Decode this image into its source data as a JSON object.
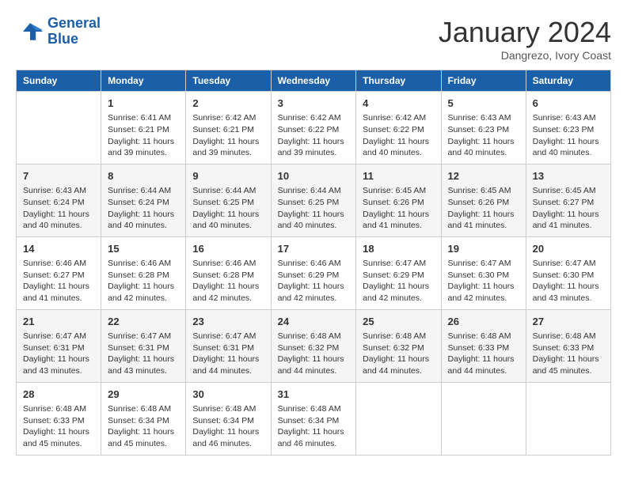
{
  "logo": {
    "line1": "General",
    "line2": "Blue"
  },
  "title": "January 2024",
  "subtitle": "Dangrezo, Ivory Coast",
  "header_days": [
    "Sunday",
    "Monday",
    "Tuesday",
    "Wednesday",
    "Thursday",
    "Friday",
    "Saturday"
  ],
  "weeks": [
    [
      {
        "day": "",
        "sunrise": "",
        "sunset": "",
        "daylight": ""
      },
      {
        "day": "1",
        "sunrise": "Sunrise: 6:41 AM",
        "sunset": "Sunset: 6:21 PM",
        "daylight": "Daylight: 11 hours and 39 minutes."
      },
      {
        "day": "2",
        "sunrise": "Sunrise: 6:42 AM",
        "sunset": "Sunset: 6:21 PM",
        "daylight": "Daylight: 11 hours and 39 minutes."
      },
      {
        "day": "3",
        "sunrise": "Sunrise: 6:42 AM",
        "sunset": "Sunset: 6:22 PM",
        "daylight": "Daylight: 11 hours and 39 minutes."
      },
      {
        "day": "4",
        "sunrise": "Sunrise: 6:42 AM",
        "sunset": "Sunset: 6:22 PM",
        "daylight": "Daylight: 11 hours and 40 minutes."
      },
      {
        "day": "5",
        "sunrise": "Sunrise: 6:43 AM",
        "sunset": "Sunset: 6:23 PM",
        "daylight": "Daylight: 11 hours and 40 minutes."
      },
      {
        "day": "6",
        "sunrise": "Sunrise: 6:43 AM",
        "sunset": "Sunset: 6:23 PM",
        "daylight": "Daylight: 11 hours and 40 minutes."
      }
    ],
    [
      {
        "day": "7",
        "sunrise": "Sunrise: 6:43 AM",
        "sunset": "Sunset: 6:24 PM",
        "daylight": "Daylight: 11 hours and 40 minutes."
      },
      {
        "day": "8",
        "sunrise": "Sunrise: 6:44 AM",
        "sunset": "Sunset: 6:24 PM",
        "daylight": "Daylight: 11 hours and 40 minutes."
      },
      {
        "day": "9",
        "sunrise": "Sunrise: 6:44 AM",
        "sunset": "Sunset: 6:25 PM",
        "daylight": "Daylight: 11 hours and 40 minutes."
      },
      {
        "day": "10",
        "sunrise": "Sunrise: 6:44 AM",
        "sunset": "Sunset: 6:25 PM",
        "daylight": "Daylight: 11 hours and 40 minutes."
      },
      {
        "day": "11",
        "sunrise": "Sunrise: 6:45 AM",
        "sunset": "Sunset: 6:26 PM",
        "daylight": "Daylight: 11 hours and 41 minutes."
      },
      {
        "day": "12",
        "sunrise": "Sunrise: 6:45 AM",
        "sunset": "Sunset: 6:26 PM",
        "daylight": "Daylight: 11 hours and 41 minutes."
      },
      {
        "day": "13",
        "sunrise": "Sunrise: 6:45 AM",
        "sunset": "Sunset: 6:27 PM",
        "daylight": "Daylight: 11 hours and 41 minutes."
      }
    ],
    [
      {
        "day": "14",
        "sunrise": "Sunrise: 6:46 AM",
        "sunset": "Sunset: 6:27 PM",
        "daylight": "Daylight: 11 hours and 41 minutes."
      },
      {
        "day": "15",
        "sunrise": "Sunrise: 6:46 AM",
        "sunset": "Sunset: 6:28 PM",
        "daylight": "Daylight: 11 hours and 42 minutes."
      },
      {
        "day": "16",
        "sunrise": "Sunrise: 6:46 AM",
        "sunset": "Sunset: 6:28 PM",
        "daylight": "Daylight: 11 hours and 42 minutes."
      },
      {
        "day": "17",
        "sunrise": "Sunrise: 6:46 AM",
        "sunset": "Sunset: 6:29 PM",
        "daylight": "Daylight: 11 hours and 42 minutes."
      },
      {
        "day": "18",
        "sunrise": "Sunrise: 6:47 AM",
        "sunset": "Sunset: 6:29 PM",
        "daylight": "Daylight: 11 hours and 42 minutes."
      },
      {
        "day": "19",
        "sunrise": "Sunrise: 6:47 AM",
        "sunset": "Sunset: 6:30 PM",
        "daylight": "Daylight: 11 hours and 42 minutes."
      },
      {
        "day": "20",
        "sunrise": "Sunrise: 6:47 AM",
        "sunset": "Sunset: 6:30 PM",
        "daylight": "Daylight: 11 hours and 43 minutes."
      }
    ],
    [
      {
        "day": "21",
        "sunrise": "Sunrise: 6:47 AM",
        "sunset": "Sunset: 6:31 PM",
        "daylight": "Daylight: 11 hours and 43 minutes."
      },
      {
        "day": "22",
        "sunrise": "Sunrise: 6:47 AM",
        "sunset": "Sunset: 6:31 PM",
        "daylight": "Daylight: 11 hours and 43 minutes."
      },
      {
        "day": "23",
        "sunrise": "Sunrise: 6:47 AM",
        "sunset": "Sunset: 6:31 PM",
        "daylight": "Daylight: 11 hours and 44 minutes."
      },
      {
        "day": "24",
        "sunrise": "Sunrise: 6:48 AM",
        "sunset": "Sunset: 6:32 PM",
        "daylight": "Daylight: 11 hours and 44 minutes."
      },
      {
        "day": "25",
        "sunrise": "Sunrise: 6:48 AM",
        "sunset": "Sunset: 6:32 PM",
        "daylight": "Daylight: 11 hours and 44 minutes."
      },
      {
        "day": "26",
        "sunrise": "Sunrise: 6:48 AM",
        "sunset": "Sunset: 6:33 PM",
        "daylight": "Daylight: 11 hours and 44 minutes."
      },
      {
        "day": "27",
        "sunrise": "Sunrise: 6:48 AM",
        "sunset": "Sunset: 6:33 PM",
        "daylight": "Daylight: 11 hours and 45 minutes."
      }
    ],
    [
      {
        "day": "28",
        "sunrise": "Sunrise: 6:48 AM",
        "sunset": "Sunset: 6:33 PM",
        "daylight": "Daylight: 11 hours and 45 minutes."
      },
      {
        "day": "29",
        "sunrise": "Sunrise: 6:48 AM",
        "sunset": "Sunset: 6:34 PM",
        "daylight": "Daylight: 11 hours and 45 minutes."
      },
      {
        "day": "30",
        "sunrise": "Sunrise: 6:48 AM",
        "sunset": "Sunset: 6:34 PM",
        "daylight": "Daylight: 11 hours and 46 minutes."
      },
      {
        "day": "31",
        "sunrise": "Sunrise: 6:48 AM",
        "sunset": "Sunset: 6:34 PM",
        "daylight": "Daylight: 11 hours and 46 minutes."
      },
      {
        "day": "",
        "sunrise": "",
        "sunset": "",
        "daylight": ""
      },
      {
        "day": "",
        "sunrise": "",
        "sunset": "",
        "daylight": ""
      },
      {
        "day": "",
        "sunrise": "",
        "sunset": "",
        "daylight": ""
      }
    ]
  ]
}
